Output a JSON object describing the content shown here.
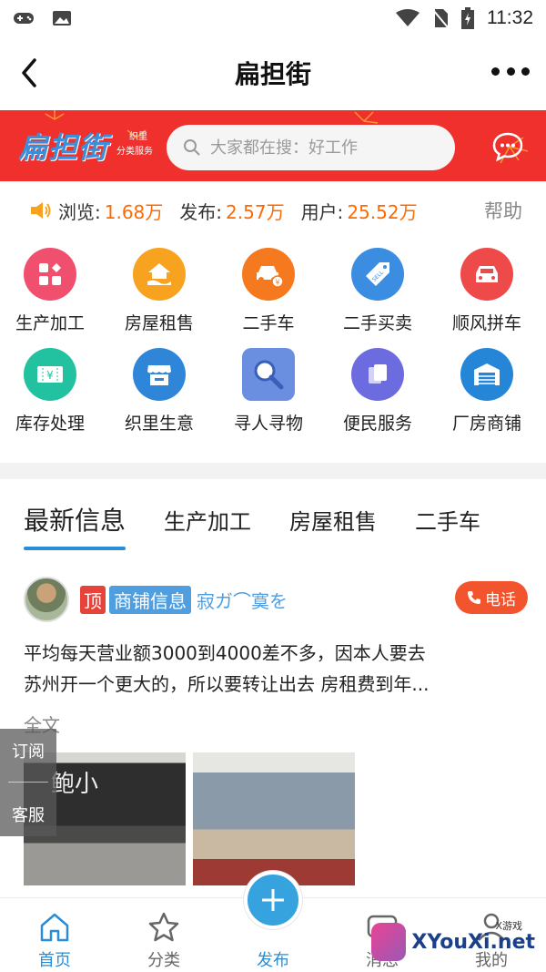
{
  "status_bar": {
    "time": "11:32"
  },
  "header": {
    "title": "扁担街"
  },
  "banner": {
    "logo_text": "扁担街",
    "logo_sub1": "织里",
    "logo_sub2": "分类服务",
    "search_placeholder": "大家都在搜：好工作"
  },
  "stats": {
    "views_label": "浏览:",
    "views_value": "1.68万",
    "posts_label": "发布:",
    "posts_value": "2.57万",
    "users_label": "用户:",
    "users_value": "25.52万",
    "help": "帮助"
  },
  "categories": [
    {
      "label": "生产加工",
      "icon": "grid-plus-icon",
      "color": "#f0506e"
    },
    {
      "label": "房屋租售",
      "icon": "house-hand-icon",
      "color": "#f7a320"
    },
    {
      "label": "二手车",
      "icon": "car-yen-icon",
      "color": "#f57a1f"
    },
    {
      "label": "二手买卖",
      "icon": "sell-tag-icon",
      "color": "#3a8de0"
    },
    {
      "label": "顺风拼车",
      "icon": "car-front-icon",
      "color": "#ef4a4a"
    },
    {
      "label": "库存处理",
      "icon": "yen-ticket-icon",
      "color": "#22c2a0"
    },
    {
      "label": "织里生意",
      "icon": "shop-icon",
      "color": "#2f86d9"
    },
    {
      "label": "寻人寻物",
      "icon": "magnifier-icon",
      "color": "#3a7fd8"
    },
    {
      "label": "便民服务",
      "icon": "cards-icon",
      "color": "#6c6ce0"
    },
    {
      "label": "厂房商铺",
      "icon": "warehouse-icon",
      "color": "#2586d8"
    }
  ],
  "tabs": [
    "最新信息",
    "生产加工",
    "房屋租售",
    "二手车"
  ],
  "post": {
    "top_tag": "顶",
    "category_tag": "商铺信息",
    "username": "寂ガ⌒寞を",
    "call_label": "电话",
    "body_line1": "平均每天营业额3000到4000差不多，因本人要去",
    "body_line2": "苏州开一个更大的，所以要转让出去 房租费到年...",
    "full_text": "全文",
    "photo1_sign": "鲍小"
  },
  "float_side": {
    "subscribe": "订阅",
    "service": "客服"
  },
  "bottom_nav": {
    "home": "首页",
    "category": "分类",
    "publish": "发布",
    "message": "消息",
    "mine": "我的"
  },
  "watermark": {
    "text": "XYouXi.net",
    "small": "X游戏"
  }
}
